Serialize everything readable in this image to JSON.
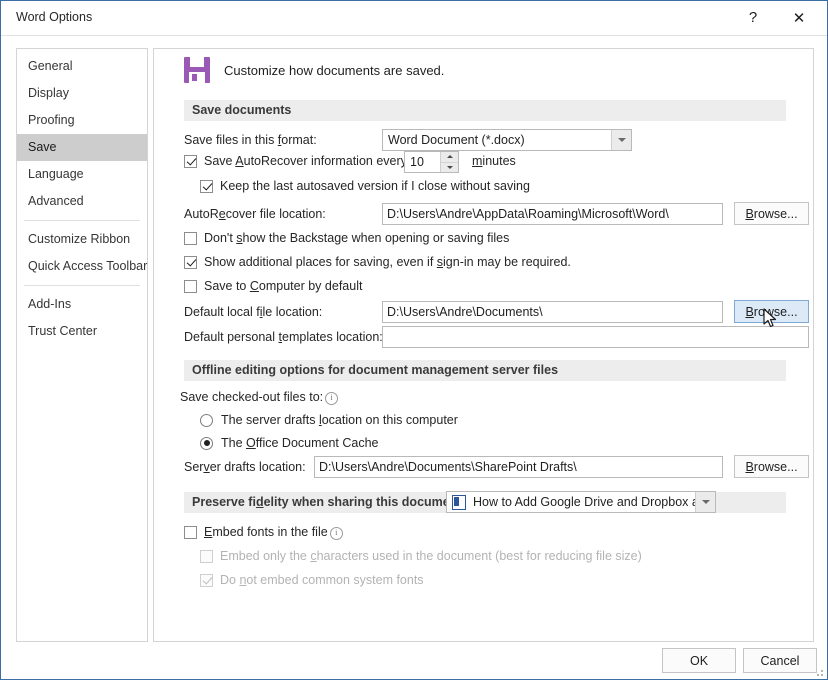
{
  "window": {
    "title": "Word Options",
    "help_label": "?",
    "close_label": "✕"
  },
  "sidebar": {
    "items": [
      {
        "label": "General",
        "selected": false
      },
      {
        "label": "Display",
        "selected": false
      },
      {
        "label": "Proofing",
        "selected": false
      },
      {
        "label": "Save",
        "selected": true
      },
      {
        "label": "Language",
        "selected": false
      },
      {
        "label": "Advanced",
        "selected": false
      },
      {
        "label": "Customize Ribbon",
        "selected": false
      },
      {
        "label": "Quick Access Toolbar",
        "selected": false
      },
      {
        "label": "Add-Ins",
        "selected": false
      },
      {
        "label": "Trust Center",
        "selected": false
      }
    ]
  },
  "page": {
    "heading": "Customize how documents are saved.",
    "heading_icon": "save-floppy-icon"
  },
  "save_documents": {
    "section_title": "Save documents",
    "format_label_pre": "Save files in this ",
    "format_label_accel": "f",
    "format_label_post": "ormat:",
    "format_value": "Word Document (*.docx)",
    "autorecover_pre": "Save ",
    "autorecover_accel": "A",
    "autorecover_mid": "utoRecover information every",
    "autorecover_checked": true,
    "autorecover_minutes": "10",
    "minutes_accel": "m",
    "minutes_post": "inutes",
    "keep_last_label": "Keep the last autosaved version if I close without saving",
    "keep_last_checked": true,
    "autorecover_loc_pre": "AutoR",
    "autorecover_loc_accel": "e",
    "autorecover_loc_post": "cover file location:",
    "autorecover_loc_value": "D:\\Users\\Andre\\AppData\\Roaming\\Microsoft\\Word\\",
    "autorecover_browse": "Browse...",
    "autorecover_browse_accel": "B",
    "backstage_pre": "Don't ",
    "backstage_accel": "s",
    "backstage_post": "how the Backstage when opening or saving files",
    "backstage_checked": false,
    "additional_pre": "Show additional places for saving, even if ",
    "additional_accel": "s",
    "additional_post": "ign-in may be required.",
    "additional_checked": true,
    "computer_pre": "Save to ",
    "computer_accel": "C",
    "computer_post": "omputer by default",
    "computer_checked": false,
    "default_local_pre": "Default local f",
    "default_local_accel": "i",
    "default_local_post": "le location:",
    "default_local_value": "D:\\Users\\Andre\\Documents\\",
    "default_local_browse": "Browse...",
    "default_local_browse_accel": "B",
    "default_templates_pre": "Default personal ",
    "default_templates_accel": "t",
    "default_templates_post": "emplates location:",
    "default_templates_value": ""
  },
  "offline_editing": {
    "section_title": "Offline editing options for document management server files",
    "checked_out_label": "Save checked-out files to:",
    "checked_out_info_icon": "info-icon",
    "options": [
      {
        "pre": "The server drafts ",
        "accel": "l",
        "post": "ocation on this computer",
        "selected": false
      },
      {
        "pre": "The ",
        "accel": "O",
        "post": "ffice Document Cache",
        "selected": true
      }
    ],
    "server_drafts_pre": "Ser",
    "server_drafts_accel": "v",
    "server_drafts_post": "er drafts location:",
    "server_drafts_value": "D:\\Users\\Andre\\Documents\\SharePoint Drafts\\",
    "server_drafts_browse": "Browse...",
    "server_drafts_browse_accel": "B"
  },
  "preserve_fidelity": {
    "section_title_pre": "Preserve fi",
    "section_title_accel": "d",
    "section_title_post": "elity when sharing this document:",
    "document_value": "How to Add Google Drive and Dropbox a...",
    "document_icon": "word-document-icon",
    "embed_fonts_pre": "",
    "embed_fonts_accel": "E",
    "embed_fonts_post": "mbed fonts in the file",
    "embed_fonts_checked": false,
    "embed_fonts_info_icon": "info-icon",
    "embed_chars_pre": "Embed only the ",
    "embed_chars_accel": "c",
    "embed_chars_post": "haracters used in the document (best for reducing file size)",
    "embed_chars_checked": false,
    "embed_chars_disabled": true,
    "no_common_pre": "Do ",
    "no_common_accel": "n",
    "no_common_post": "ot embed common system fonts",
    "no_common_checked": true,
    "no_common_disabled": true
  },
  "footer": {
    "ok_label": "OK",
    "cancel_label": "Cancel"
  },
  "colors": {
    "window_border": "#3a6ea5",
    "sidebar_selected": "#cdcdcd",
    "section_band": "#ededed",
    "accent_purple": "#9b59b6",
    "hover_blue": "#dceaf8",
    "word_blue": "#2b579a"
  }
}
